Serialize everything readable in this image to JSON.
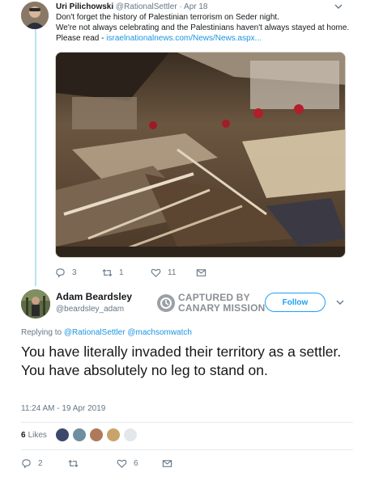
{
  "parent_tweet": {
    "author_name": "Uri Pilichowski",
    "author_handle": "@RationalSettler",
    "separator": "·",
    "date": "Apr 18",
    "text_line1": "Don't forget the history of Palestinian terrorism on Seder night.",
    "text_line2": "We're not always celebrating and the Palestinians haven't always stayed at home.",
    "text_line3_prefix": "Please read - ",
    "link_text": "israelnationalnews.com/News/News.aspx...",
    "actions": {
      "replies": "3",
      "retweets": "1",
      "likes": "11"
    }
  },
  "main_tweet": {
    "author_name": "Adam Beardsley",
    "author_handle": "@beardsley_adam",
    "follow_label": "Follow",
    "reply_to_prefix": "Replying to ",
    "reply_to_handle1": "@RationalSettler",
    "reply_to_handle2": "@machsomwatch",
    "text": "You have literally invaded their territory as a settler. You have absolutely no leg to stand on.",
    "timestamp": "11:24 AM - 19 Apr 2019",
    "likes_count": "6",
    "likes_label": "Likes",
    "actions": {
      "replies": "2",
      "retweets": "",
      "likes": "6"
    }
  },
  "watermark": {
    "line1": "CAPTURED BY",
    "line2": "CANARY MISSION"
  },
  "icons": [
    "reply-icon",
    "retweet-icon",
    "like-icon",
    "message-icon",
    "chevron-down-icon",
    "canary-mission-icon"
  ],
  "colors": {
    "link": "#1b95e0",
    "follow": "#1da1f2",
    "muted": "#657786",
    "thread_line": "#b8e2f8"
  }
}
